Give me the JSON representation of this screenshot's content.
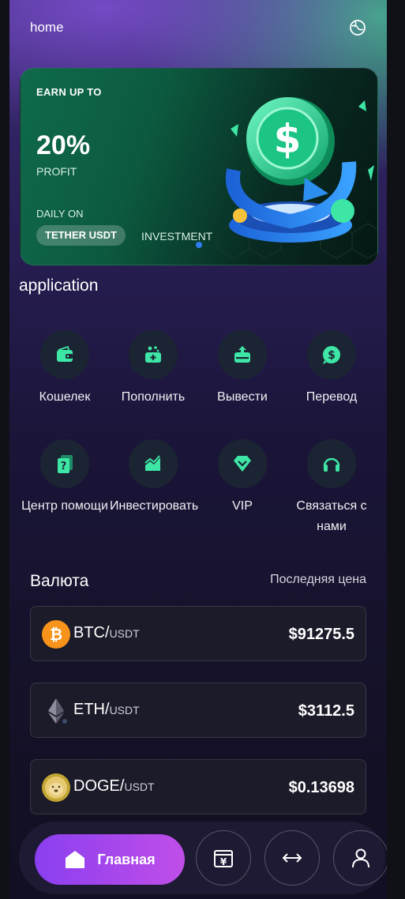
{
  "header": {
    "title": "home",
    "globe_icon": "globe-icon"
  },
  "banner": {
    "earn": "EARN UP TO",
    "percent": "20%",
    "profit": "PROFIT",
    "daily": "DAILY ON",
    "pill": "TETHER USDT",
    "investment": "INVESTMENT"
  },
  "application": {
    "title": "application",
    "actions": [
      {
        "label": "Кошелек",
        "icon": "wallet-icon"
      },
      {
        "label": "Пополнить",
        "icon": "deposit-icon"
      },
      {
        "label": "Вывести",
        "icon": "withdraw-icon"
      },
      {
        "label": "Перевод",
        "icon": "transfer-icon"
      },
      {
        "label": "Центр помощи",
        "icon": "help-icon"
      },
      {
        "label": "Инвестировать",
        "icon": "invest-chart-icon"
      },
      {
        "label": "VIP",
        "icon": "vip-diamond-icon"
      },
      {
        "label": "Связаться с нами",
        "icon": "headphones-icon"
      }
    ]
  },
  "currency": {
    "title": "Валюта",
    "last_price_label": "Последняя цена",
    "rows": [
      {
        "base": "BTC/",
        "quote": "USDT",
        "price": "$91275.5",
        "icon": "bitcoin-icon"
      },
      {
        "base": "ETH/",
        "quote": "USDT",
        "price": "$3112.5",
        "icon": "ethereum-icon"
      },
      {
        "base": "DOGE/",
        "quote": "USDT",
        "price": "$0.13698",
        "icon": "dogecoin-icon"
      }
    ]
  },
  "nav": {
    "home_label": "Главная",
    "items": [
      "home-icon",
      "yen-wallet-icon",
      "exchange-arrows-icon",
      "user-icon"
    ]
  },
  "colors": {
    "accent_green": "#3ee6a6",
    "nav_gradient_start": "#8a3ff0",
    "nav_gradient_end": "#c04ee8"
  }
}
